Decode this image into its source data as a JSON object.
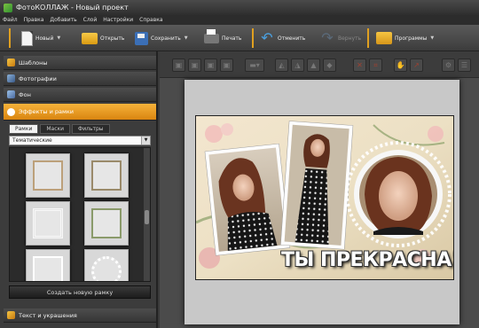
{
  "window": {
    "title": "ФотоКОЛЛАЖ - Новый проект"
  },
  "menu": [
    "Файл",
    "Правка",
    "Добавить",
    "Слой",
    "Настройки",
    "Справка"
  ],
  "toolbar": {
    "new_label": "Новый",
    "open_label": "Открыть",
    "save_label": "Сохранить",
    "print_label": "Печать",
    "undo_label": "Отменить",
    "redo_label": "Вернуть",
    "programs_label": "Программы"
  },
  "sidebar": {
    "sections": {
      "templates": "Шаблоны",
      "photos": "Фотографии",
      "background": "Фон",
      "effects": "Эффекты и рамки",
      "text": "Текст и украшения"
    },
    "tabs": [
      "Рамки",
      "Маски",
      "Фильтры"
    ],
    "category_selected": "Тематические",
    "create_button": "Создать новую рамку"
  },
  "collage": {
    "slogan": "ТЫ ПРЕКРАСНА!"
  },
  "colors": {
    "accent": "#e89a22",
    "panel": "#3c3c3c",
    "canvas_bg": "#4b4b4b"
  }
}
